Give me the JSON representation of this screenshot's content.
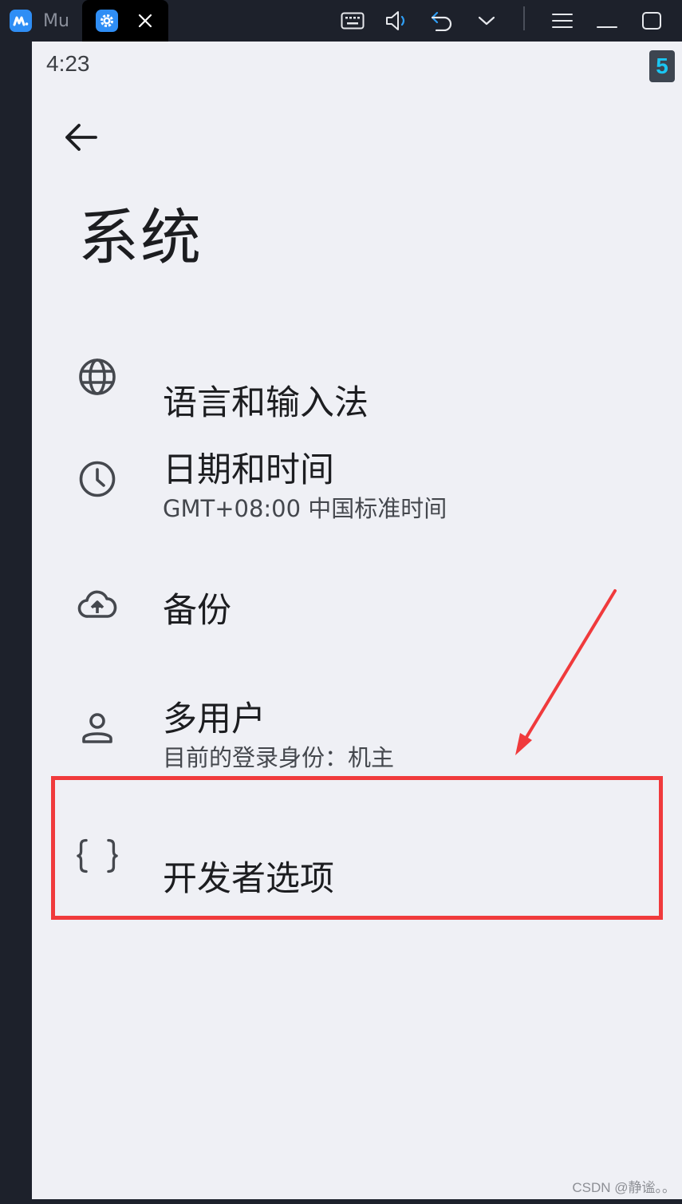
{
  "titlebar": {
    "tabs": [
      {
        "label": "Mu",
        "icon": "mumu-logo-icon"
      },
      {
        "label": "",
        "icon": "settings-gear-icon"
      }
    ],
    "toolbar_icons": [
      "keyboard-icon",
      "volume-icon",
      "undo-icon",
      "chevron-down-icon",
      "menu-icon",
      "minimize-icon",
      "maximize-icon"
    ]
  },
  "status_bar": {
    "time": "4:23",
    "badge": "5"
  },
  "page": {
    "title": "系统",
    "back_icon": "arrow-back-icon"
  },
  "items": [
    {
      "title": "语言和输入法",
      "subtitle": "",
      "icon": "globe-icon"
    },
    {
      "title": "日期和时间",
      "subtitle": "GMT+08:00 中国标准时间",
      "icon": "clock-icon"
    },
    {
      "title": "备份",
      "subtitle": "",
      "icon": "cloud-upload-icon"
    },
    {
      "title": "多用户",
      "subtitle": "目前的登录身份：机主",
      "icon": "person-icon"
    },
    {
      "title": "开发者选项",
      "subtitle": "",
      "icon": "braces-icon"
    }
  ],
  "annotation": {
    "highlight_color": "#f03a3c",
    "highlighted_item": "开发者选项"
  },
  "watermark": "CSDN @静谧。。"
}
